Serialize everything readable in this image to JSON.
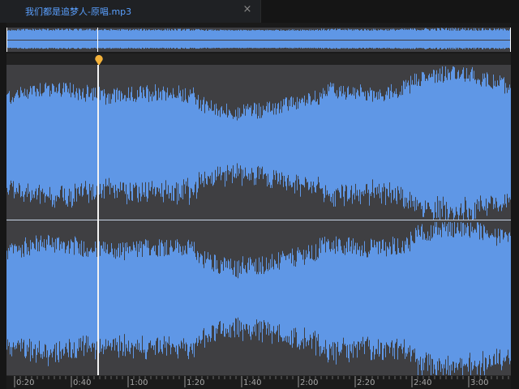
{
  "tab": {
    "title": "我们都是追梦人-原唱.mp3",
    "close_glyph": "×"
  },
  "colors": {
    "waveform_fill": "#5f97e6",
    "background": "#1a1a1a",
    "tab_text": "#5aa0ff",
    "marker": "#f4b23a",
    "playhead": "#f3f3f3"
  },
  "icons": {
    "tab_close": "close-icon",
    "marker": "marker-pin-icon"
  },
  "ruler": {
    "labels": [
      "0:20",
      "0:40",
      "1:00",
      "1:20",
      "1:40",
      "2:00",
      "2:20",
      "2:40",
      "3:00"
    ]
  }
}
